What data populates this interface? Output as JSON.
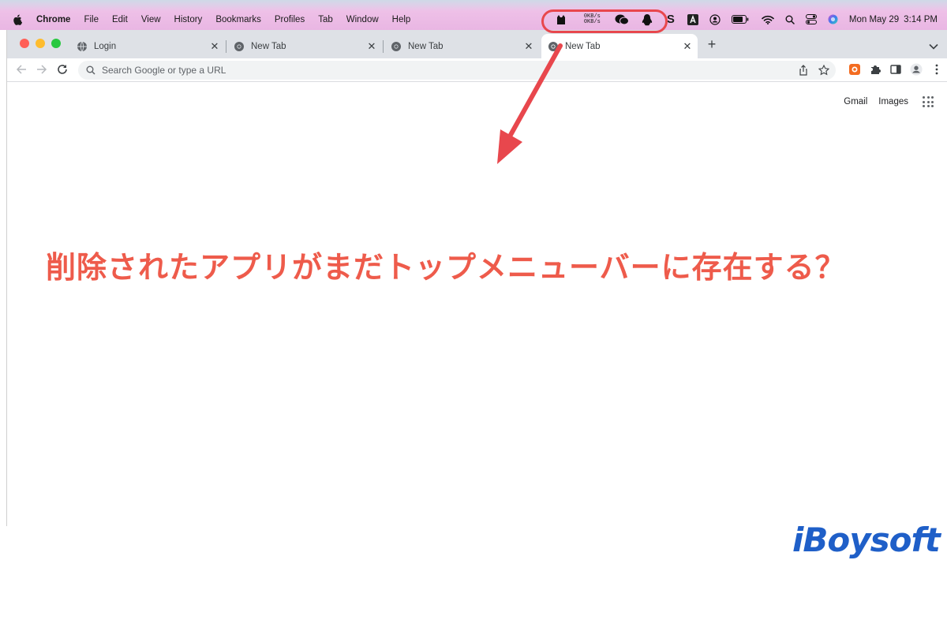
{
  "menubar": {
    "app": "Chrome",
    "menus": [
      "File",
      "Edit",
      "View",
      "History",
      "Bookmarks",
      "Profiles",
      "Tab",
      "Window",
      "Help"
    ],
    "net_up": "0KB/s",
    "net_down": "0KB/s",
    "date": "Mon May 29",
    "time": "3:14 PM",
    "icons": [
      "cat-icon",
      "netspeed",
      "wechat-icon",
      "qq-penguin-icon",
      "s-icon",
      "a-input-icon",
      "user-circle-icon",
      "battery-icon",
      "wifi-icon",
      "spotlight-icon",
      "control-center-icon",
      "siri-icon"
    ]
  },
  "tabs": [
    {
      "title": "Login",
      "favicon": "globe-icon"
    },
    {
      "title": "New Tab",
      "favicon": "chrome-icon"
    },
    {
      "title": "New Tab",
      "favicon": "chrome-icon"
    },
    {
      "title": "New Tab",
      "favicon": "chrome-icon",
      "active": true
    }
  ],
  "toolbar": {
    "placeholder": "Search Google or type a URL"
  },
  "newtab_links": {
    "gmail": "Gmail",
    "images": "Images"
  },
  "headline": "削除されたアプリがまだトップメニューバーに存在する？",
  "brand": "iBoysoft",
  "colors": {
    "accent": "#ee5b4b",
    "callout": "#e8474d",
    "brand": "#1f5fc8",
    "menubar": "#f1c6ea"
  }
}
